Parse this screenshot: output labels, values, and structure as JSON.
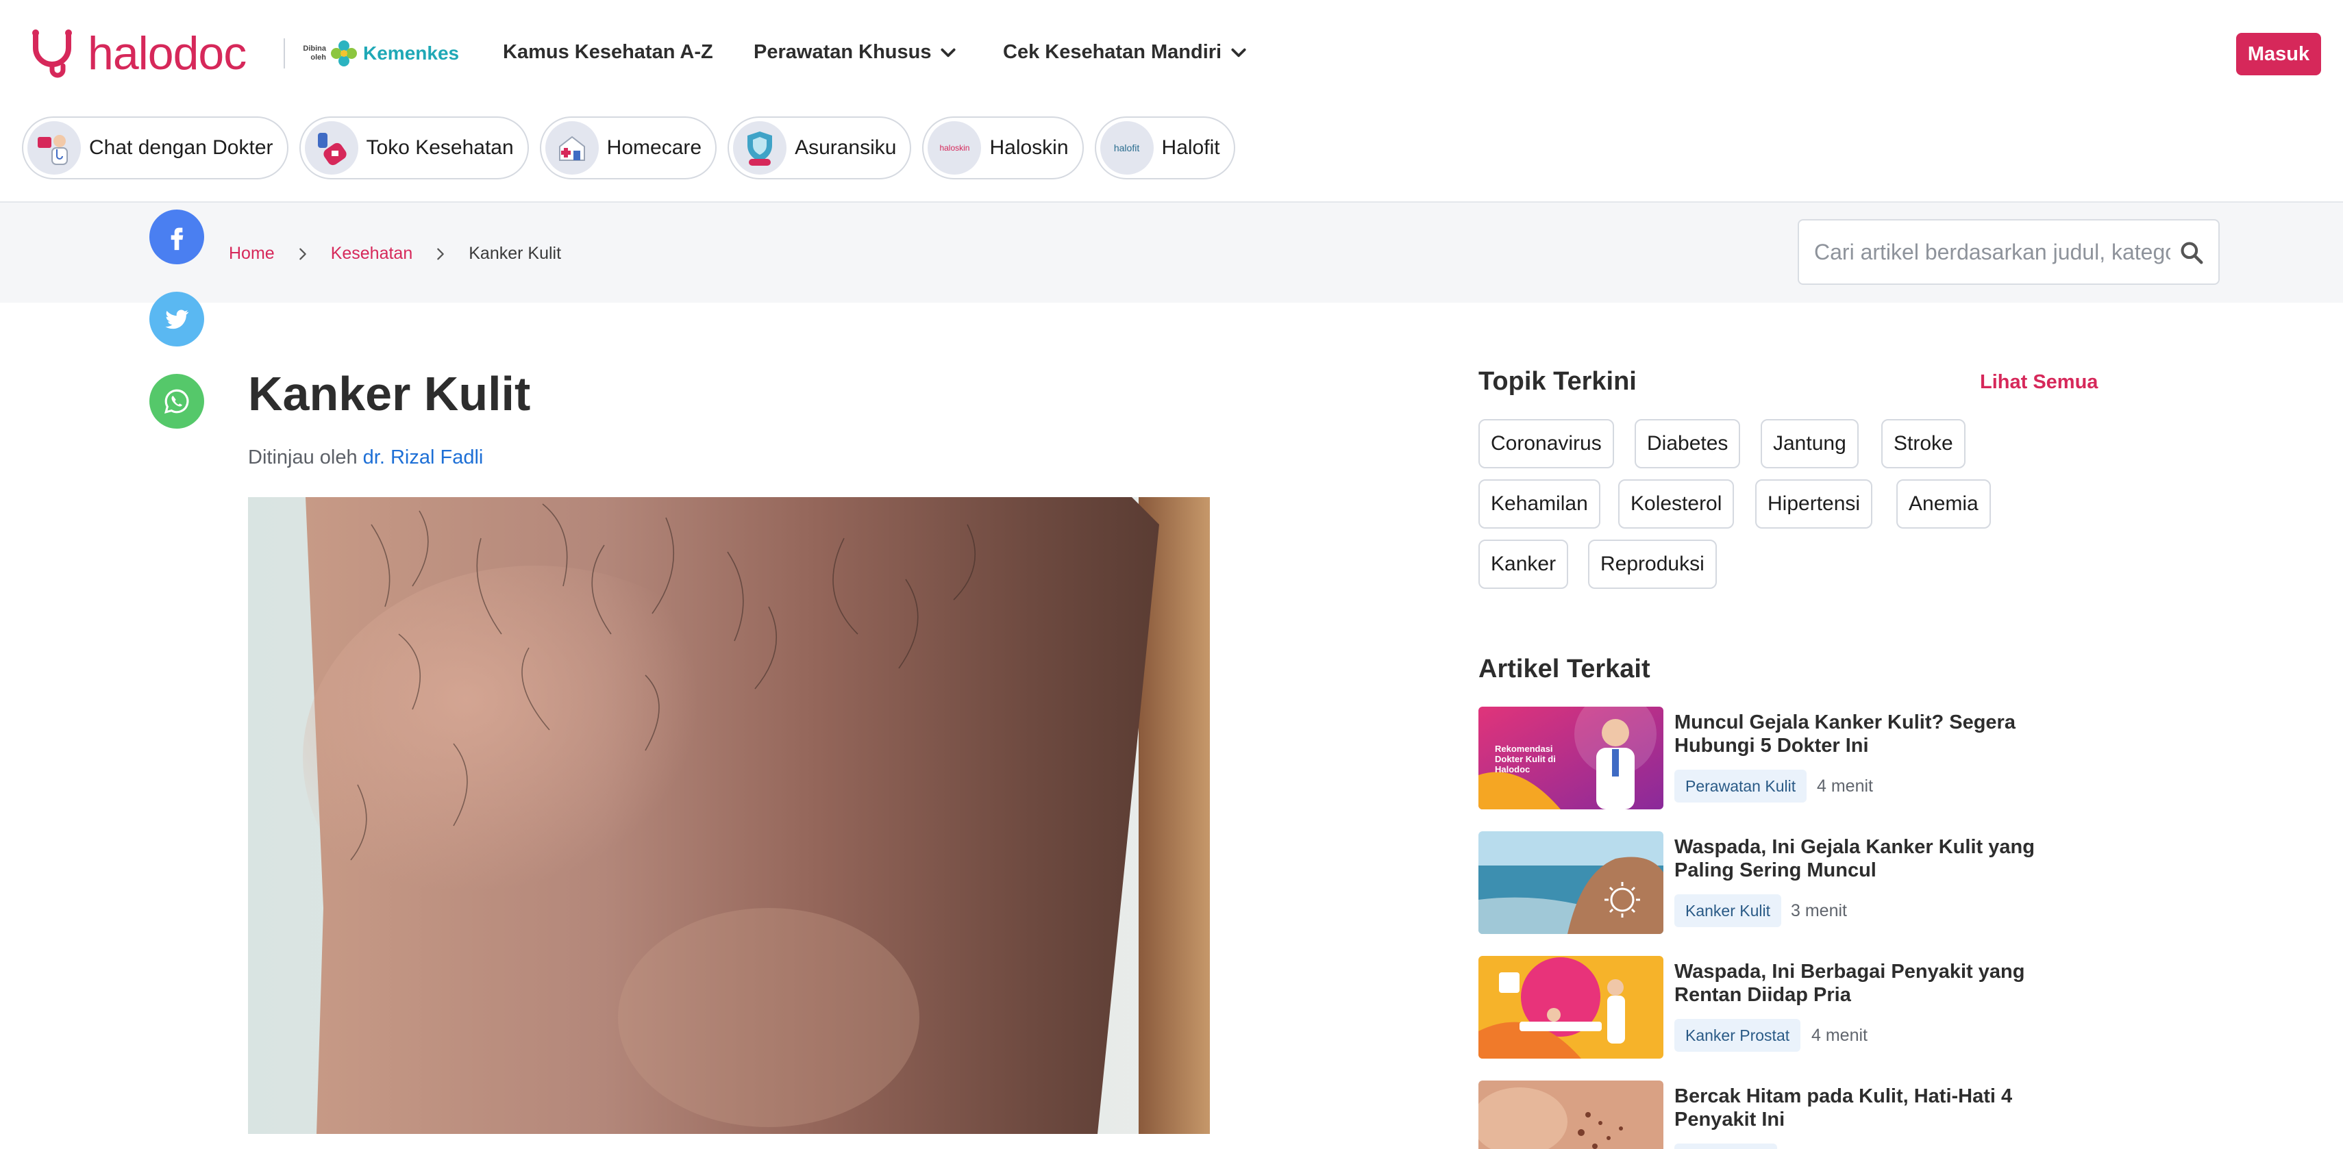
{
  "brand": {
    "logo_text": "halodoc",
    "partner_prefix": "Dibina oleh",
    "partner_name": "Kemenkes",
    "accent_color": "#d6285a"
  },
  "nav": {
    "menu": [
      {
        "label": "Kamus Kesehatan A-Z",
        "has_dropdown": false
      },
      {
        "label": "Perawatan Khusus",
        "has_dropdown": true
      },
      {
        "label": "Cek Kesehatan Mandiri",
        "has_dropdown": true
      }
    ],
    "login_label": "Masuk"
  },
  "services": [
    {
      "label": "Chat dengan Dokter",
      "icon": "doctor-chat-icon"
    },
    {
      "label": "Toko Kesehatan",
      "icon": "pharmacy-icon"
    },
    {
      "label": "Homecare",
      "icon": "homecare-icon"
    },
    {
      "label": "Asuransiku",
      "icon": "insurance-shield-icon"
    },
    {
      "label": "Haloskin",
      "icon": "haloskin-logo",
      "badge": "haloskin"
    },
    {
      "label": "Halofit",
      "icon": "halofit-logo",
      "badge": "halofit"
    }
  ],
  "breadcrumb": {
    "items": [
      "Home",
      "Kesehatan",
      "Kanker Kulit"
    ]
  },
  "search": {
    "placeholder": "Cari artikel berdasarkan judul, kategori",
    "value": ""
  },
  "share": [
    "facebook-icon",
    "twitter-icon",
    "whatsapp-icon"
  ],
  "article": {
    "title": "Kanker Kulit",
    "reviewed_prefix": "Ditinjau oleh",
    "reviewer": "dr. Rizal Fadli"
  },
  "sidebar": {
    "topics_heading": "Topik Terkini",
    "see_all": "Lihat Semua",
    "topics": [
      "Coronavirus",
      "Diabetes",
      "Jantung",
      "Stroke",
      "Kehamilan",
      "Kolesterol",
      "Hipertensi",
      "Anemia",
      "Kanker",
      "Reproduksi"
    ],
    "related_heading": "Artikel Terkait",
    "related": [
      {
        "title": "Muncul Gejala Kanker Kulit? Segera Hubungi 5 Dokter Ini",
        "tag": "Perawatan Kulit",
        "time": "4 menit",
        "thumb_text": "Rekomendasi Dokter Kulit di Halodoc"
      },
      {
        "title": "Waspada, Ini Gejala Kanker Kulit yang Paling Sering Muncul",
        "tag": "Kanker Kulit",
        "time": "3 menit"
      },
      {
        "title": "Waspada, Ini Berbagai Penyakit yang Rentan Diidap Pria",
        "tag": "Kanker Prostat",
        "time": "4 menit"
      },
      {
        "title": "Bercak Hitam pada Kulit, Hati-Hati 4 Penyakit Ini",
        "tag": "",
        "time": ""
      }
    ]
  }
}
